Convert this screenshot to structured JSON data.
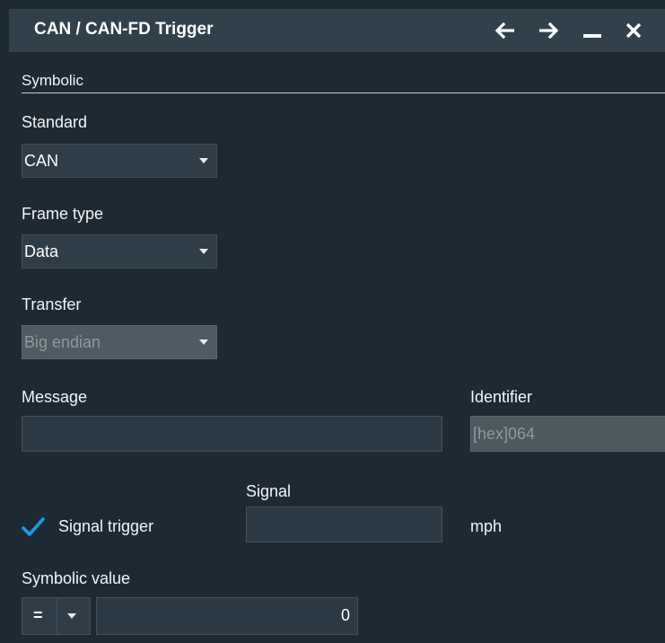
{
  "window": {
    "title": "CAN / CAN-FD Trigger",
    "buttons": [
      {
        "name": "back",
        "glyph": "←"
      },
      {
        "name": "forward",
        "glyph": "→"
      },
      {
        "name": "minimize",
        "glyph": "—"
      },
      {
        "name": "close",
        "glyph": "✕"
      }
    ]
  },
  "section": {
    "label": "Symbolic"
  },
  "standard": {
    "label": "Standard",
    "value": "CAN"
  },
  "frame_type": {
    "label": "Frame type",
    "value": "Data"
  },
  "transfer": {
    "label": "Transfer",
    "value": "Big endian",
    "enabled": false
  },
  "message": {
    "label": "Message",
    "value": ""
  },
  "identifier": {
    "label": "Identifier",
    "value": "[hex]064",
    "enabled": false
  },
  "signal": {
    "label": "Signal",
    "value": "",
    "unit": "mph"
  },
  "signal_trigger": {
    "label": "Signal trigger",
    "checked": true
  },
  "symbolic_value": {
    "label": "Symbolic value",
    "operator": "=",
    "value": "0"
  },
  "colors": {
    "accent": "#1e9ae6",
    "background": "#1e2a33",
    "titlebar": "#31414c"
  }
}
